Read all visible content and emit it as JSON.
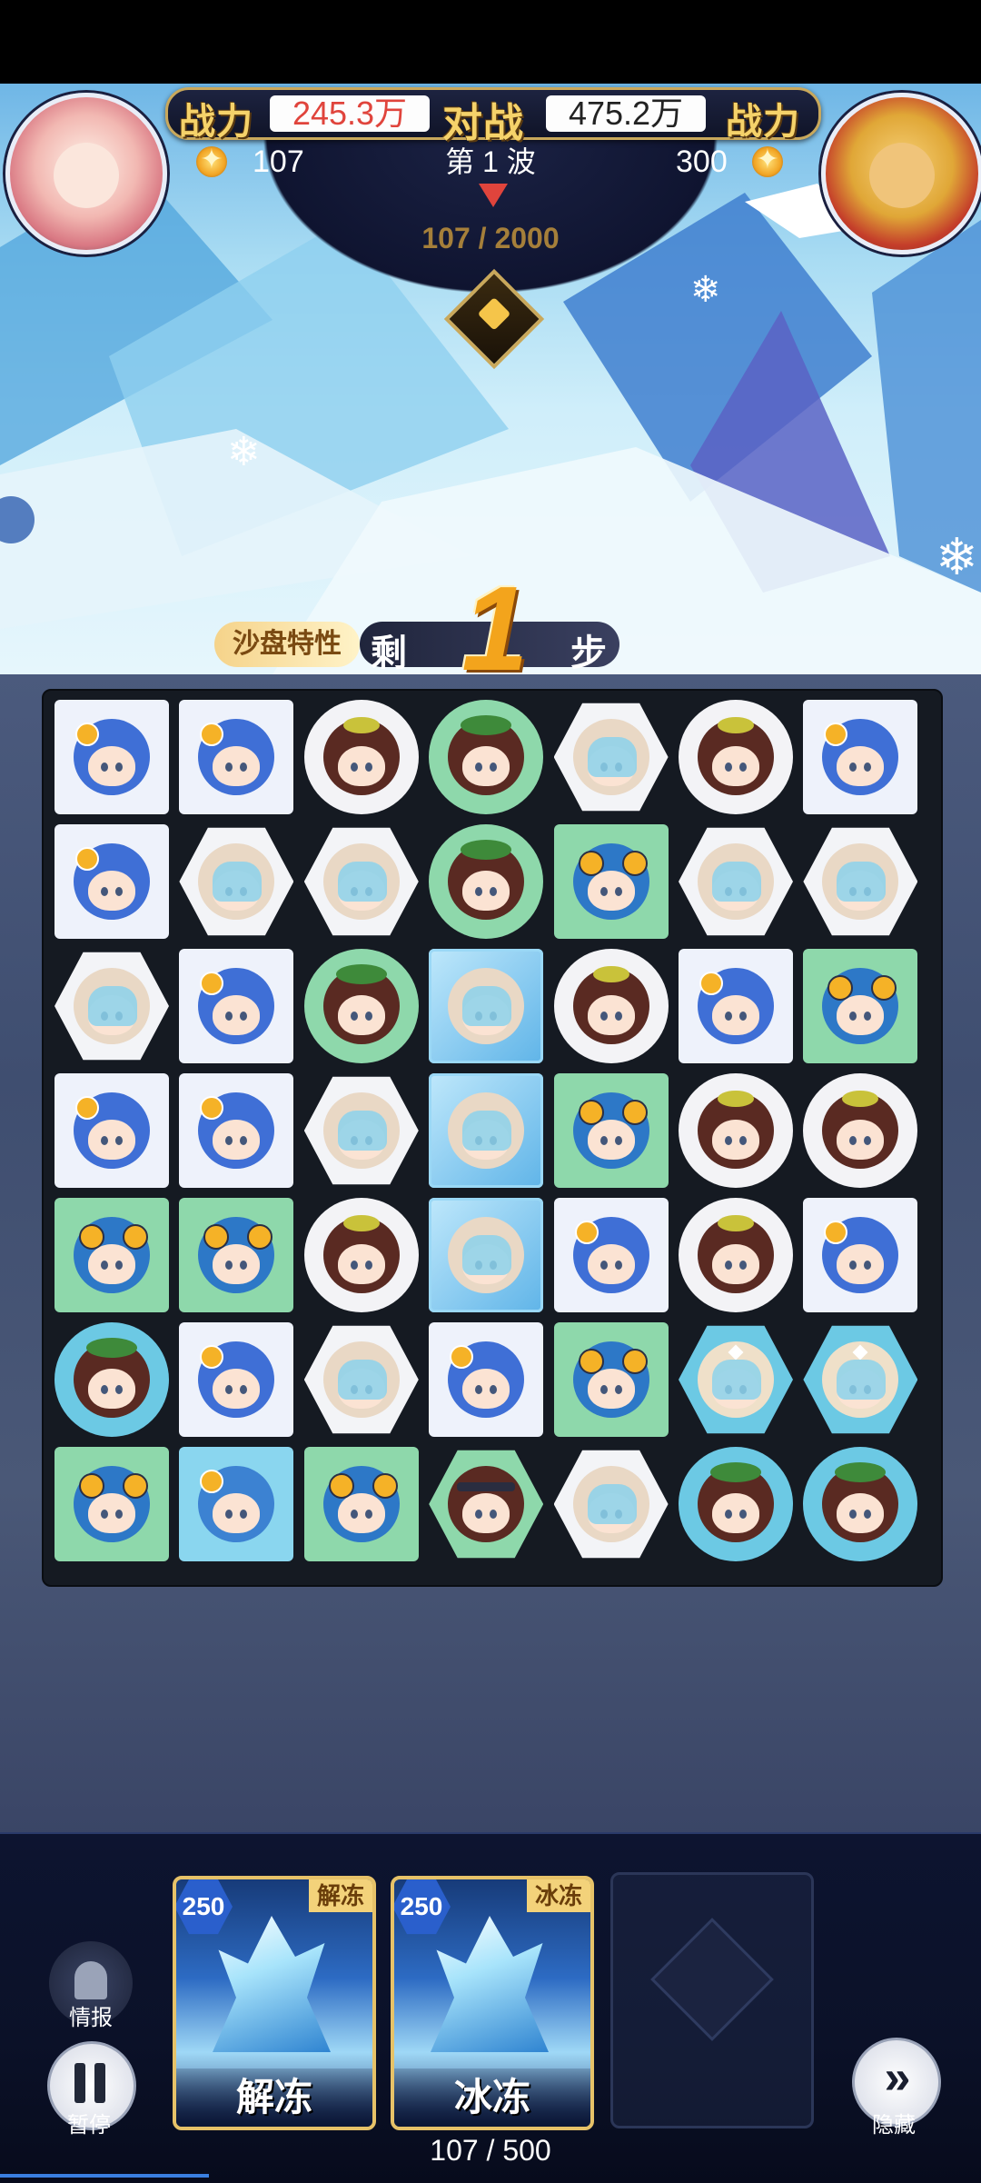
{
  "header": {
    "left_power_label": "战力",
    "left_power_value": "245.3万",
    "vs_label": "对战",
    "right_power_value": "475.2万",
    "right_power_label": "战力",
    "left_score": "107",
    "right_score": "300",
    "wave_label": "第 1 波",
    "progress": "107 / 2000"
  },
  "steps": {
    "trait_label": "沙盘特性",
    "left_label": "剩",
    "count": "1",
    "unit_label": "步"
  },
  "board": {
    "rows": [
      [
        "blue-coin",
        "blue-coin",
        "brown-leaf",
        "brown-leafg",
        "beige-visor",
        "brown-leaf",
        "blue-coin"
      ],
      [
        "blue-coin",
        "beige-visor",
        "beige-visor",
        "brown-leafg",
        "goggle",
        "beige-visor",
        "beige-visor"
      ],
      [
        "beige-visor",
        "blue-coin",
        "brown-leafg",
        "ice",
        "brown-leaf",
        "blue-coin",
        "goggle"
      ],
      [
        "blue-coin",
        "blue-coin",
        "beige-visor",
        "ice",
        "goggle",
        "brown-leaf",
        "brown-leaf"
      ],
      [
        "goggle",
        "goggle",
        "brown-leaf",
        "ice",
        "blue-coin",
        "brown-leaf",
        "blue-coin"
      ],
      [
        "brown-leafb",
        "blue-coin",
        "beige-visor",
        "blue-coin",
        "goggle",
        "hood",
        "hood"
      ],
      [
        "goggle",
        "helmet",
        "goggle",
        "band",
        "beige-visor",
        "brown-leafb",
        "brown-leafb"
      ]
    ]
  },
  "skills": [
    {
      "cost": "250",
      "tag": "解冻",
      "name": "解冻"
    },
    {
      "cost": "250",
      "tag": "冰冻",
      "name": "冰冻"
    }
  ],
  "controls": {
    "intel_label": "情报",
    "pause_label": "暂停",
    "hide_label": "隐藏"
  },
  "resource": "107 / 500",
  "colors": {
    "accent_gold": "#f5d26a",
    "power_red": "#e0443c",
    "step_orange": "#f3a41c"
  }
}
